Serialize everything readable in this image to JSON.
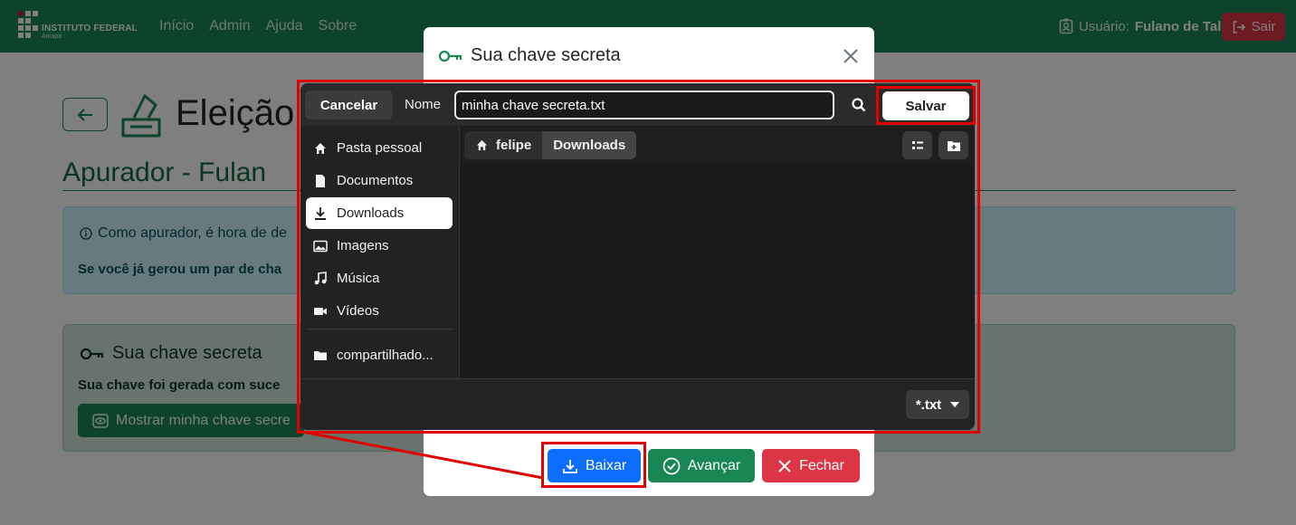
{
  "navbar": {
    "brand_name": "INSTITUTO FEDERAL",
    "brand_sub": "Amapá",
    "links": [
      "Início",
      "Admin",
      "Ajuda",
      "Sobre"
    ],
    "user_label": "Usuário:",
    "user_name": "Fulano de Tal",
    "logout_label": "Sair"
  },
  "page": {
    "title": "Eleição",
    "section_title": "Apurador - Fulan",
    "info_line1": "Como apurador, é hora de de",
    "info_line2": "Se você já gerou um par de cha",
    "key_card_title": "Sua chave secreta",
    "key_card_text": "Sua chave foi gerada com suce",
    "show_key_label": "Mostrar minha chave secre"
  },
  "modal": {
    "title": "Sua chave secreta",
    "buttons": {
      "download": "Baixar",
      "next": "Avançar",
      "close": "Fechar"
    }
  },
  "file_chooser": {
    "cancel_label": "Cancelar",
    "name_label": "Nome",
    "filename_value": "minha chave secreta.txt",
    "save_label": "Salvar",
    "sidebar": [
      {
        "label": "Pasta pessoal",
        "icon": "home-icon"
      },
      {
        "label": "Documentos",
        "icon": "document-icon"
      },
      {
        "label": "Downloads",
        "icon": "download-icon",
        "active": true
      },
      {
        "label": "Imagens",
        "icon": "image-icon"
      },
      {
        "label": "Música",
        "icon": "music-icon"
      },
      {
        "label": "Vídeos",
        "icon": "video-icon"
      },
      {
        "label": "compartilhado...",
        "icon": "folder-icon"
      }
    ],
    "breadcrumb": [
      "felipe",
      "Downloads"
    ],
    "filter_label": "*.txt"
  },
  "colors": {
    "navbar": "#198754",
    "highlight": "#e00000",
    "primary": "#0d6efd",
    "success": "#198754",
    "danger": "#dc3545"
  }
}
